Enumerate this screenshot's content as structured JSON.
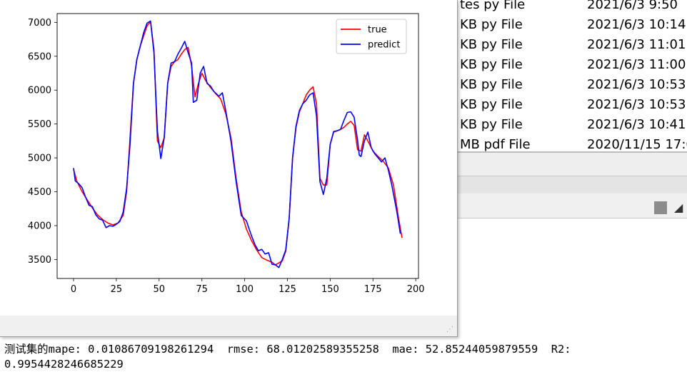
{
  "explorer": {
    "files": [
      {
        "name": "tes py File",
        "date": "2021/6/3 9:50"
      },
      {
        "name": "KB py File",
        "date": "2021/6/3 10:14"
      },
      {
        "name": "KB py File",
        "date": "2021/6/3 11:01"
      },
      {
        "name": "KB py File",
        "date": "2021/6/3 11:00"
      },
      {
        "name": "KB py File",
        "date": "2021/6/3 10:53"
      },
      {
        "name": "KB py File",
        "date": "2021/6/3 10:53"
      },
      {
        "name": "KB py File",
        "date": "2021/6/3 10:41"
      },
      {
        "name": "MB pdf File",
        "date": "2020/11/15 17:0"
      }
    ]
  },
  "console": {
    "line1": "测试集的mape: 0.01086709198261294  rmse: 68.01202589355258  mae: 52.85244059879559  R2:",
    "line2": "0.9954428246685229"
  },
  "chart_data": {
    "type": "line",
    "title": "",
    "xlabel": "",
    "ylabel": "",
    "xlim": [
      -9.6,
      201.6
    ],
    "ylim": [
      3220,
      7130
    ],
    "xticks": [
      0,
      25,
      50,
      75,
      100,
      125,
      150,
      175,
      200
    ],
    "yticks": [
      3500,
      4000,
      4500,
      5000,
      5500,
      6000,
      6500,
      7000
    ],
    "legend_position": "top-right",
    "grid": false,
    "series": [
      {
        "name": "true",
        "color": "#ff0000",
        "points": [
          [
            0,
            4830
          ],
          [
            2,
            4650
          ],
          [
            5,
            4500
          ],
          [
            8,
            4380
          ],
          [
            11,
            4260
          ],
          [
            14,
            4160
          ],
          [
            17,
            4090
          ],
          [
            20,
            4040
          ],
          [
            23,
            4010
          ],
          [
            26,
            4040
          ],
          [
            29,
            4150
          ],
          [
            31,
            4500
          ],
          [
            33,
            5300
          ],
          [
            35,
            6100
          ],
          [
            37,
            6450
          ],
          [
            39,
            6650
          ],
          [
            41,
            6800
          ],
          [
            43,
            6950
          ],
          [
            45,
            7010
          ],
          [
            47,
            6600
          ],
          [
            49,
            5250
          ],
          [
            51,
            5150
          ],
          [
            53,
            5300
          ],
          [
            55,
            6100
          ],
          [
            57,
            6350
          ],
          [
            59,
            6420
          ],
          [
            61,
            6450
          ],
          [
            63,
            6530
          ],
          [
            65,
            6600
          ],
          [
            67,
            6630
          ],
          [
            69,
            6350
          ],
          [
            71,
            5900
          ],
          [
            73,
            6100
          ],
          [
            75,
            6250
          ],
          [
            77,
            6150
          ],
          [
            80,
            6040
          ],
          [
            83,
            5950
          ],
          [
            86,
            5870
          ],
          [
            89,
            5650
          ],
          [
            92,
            5300
          ],
          [
            95,
            4700
          ],
          [
            98,
            4200
          ],
          [
            101,
            3950
          ],
          [
            104,
            3780
          ],
          [
            107,
            3640
          ],
          [
            110,
            3530
          ],
          [
            113,
            3490
          ],
          [
            116,
            3460
          ],
          [
            118,
            3420
          ],
          [
            120,
            3450
          ],
          [
            122,
            3480
          ],
          [
            124,
            3620
          ],
          [
            126,
            4100
          ],
          [
            128,
            5000
          ],
          [
            130,
            5450
          ],
          [
            132,
            5680
          ],
          [
            134,
            5800
          ],
          [
            136,
            5930
          ],
          [
            138,
            6000
          ],
          [
            140,
            6050
          ],
          [
            142,
            5800
          ],
          [
            144,
            4700
          ],
          [
            146,
            4600
          ],
          [
            148,
            4600
          ],
          [
            150,
            5200
          ],
          [
            152,
            5380
          ],
          [
            154,
            5400
          ],
          [
            156,
            5420
          ],
          [
            158,
            5450
          ],
          [
            160,
            5500
          ],
          [
            162,
            5540
          ],
          [
            164,
            5480
          ],
          [
            166,
            5120
          ],
          [
            168,
            5100
          ],
          [
            170,
            5340
          ],
          [
            172,
            5250
          ],
          [
            175,
            5100
          ],
          [
            178,
            5020
          ],
          [
            181,
            4950
          ],
          [
            184,
            4850
          ],
          [
            187,
            4600
          ],
          [
            190,
            4100
          ],
          [
            192,
            3820
          ]
        ]
      },
      {
        "name": "predict",
        "color": "#0000ff",
        "points": [
          [
            0,
            4850
          ],
          [
            1,
            4660
          ],
          [
            3,
            4620
          ],
          [
            5,
            4560
          ],
          [
            7,
            4420
          ],
          [
            9,
            4300
          ],
          [
            11,
            4280
          ],
          [
            13,
            4160
          ],
          [
            15,
            4100
          ],
          [
            17,
            4080
          ],
          [
            19,
            3970
          ],
          [
            21,
            4000
          ],
          [
            23,
            3990
          ],
          [
            25,
            4020
          ],
          [
            27,
            4060
          ],
          [
            29,
            4200
          ],
          [
            31,
            4550
          ],
          [
            33,
            5200
          ],
          [
            35,
            6100
          ],
          [
            37,
            6450
          ],
          [
            39,
            6650
          ],
          [
            41,
            6850
          ],
          [
            43,
            6990
          ],
          [
            45,
            7020
          ],
          [
            47,
            6550
          ],
          [
            49,
            5400
          ],
          [
            51,
            4990
          ],
          [
            53,
            5300
          ],
          [
            55,
            6100
          ],
          [
            57,
            6400
          ],
          [
            59,
            6420
          ],
          [
            61,
            6530
          ],
          [
            63,
            6620
          ],
          [
            65,
            6720
          ],
          [
            67,
            6550
          ],
          [
            69,
            6400
          ],
          [
            70,
            5820
          ],
          [
            72,
            5850
          ],
          [
            74,
            6250
          ],
          [
            76,
            6350
          ],
          [
            78,
            6100
          ],
          [
            80,
            6060
          ],
          [
            82,
            5980
          ],
          [
            85,
            5910
          ],
          [
            87,
            5960
          ],
          [
            89,
            5690
          ],
          [
            92,
            5250
          ],
          [
            95,
            4650
          ],
          [
            98,
            4150
          ],
          [
            101,
            4070
          ],
          [
            104,
            3850
          ],
          [
            106,
            3720
          ],
          [
            108,
            3630
          ],
          [
            110,
            3650
          ],
          [
            112,
            3580
          ],
          [
            114,
            3600
          ],
          [
            116,
            3430
          ],
          [
            118,
            3420
          ],
          [
            120,
            3380
          ],
          [
            122,
            3500
          ],
          [
            124,
            3640
          ],
          [
            126,
            4100
          ],
          [
            128,
            5000
          ],
          [
            130,
            5470
          ],
          [
            132,
            5700
          ],
          [
            134,
            5800
          ],
          [
            136,
            5850
          ],
          [
            138,
            5930
          ],
          [
            140,
            5960
          ],
          [
            142,
            5620
          ],
          [
            144,
            4650
          ],
          [
            146,
            4460
          ],
          [
            148,
            4700
          ],
          [
            150,
            5200
          ],
          [
            152,
            5390
          ],
          [
            154,
            5400
          ],
          [
            156,
            5420
          ],
          [
            158,
            5550
          ],
          [
            160,
            5670
          ],
          [
            162,
            5680
          ],
          [
            164,
            5600
          ],
          [
            166,
            5260
          ],
          [
            167,
            5040
          ],
          [
            168,
            5020
          ],
          [
            170,
            5250
          ],
          [
            172,
            5380
          ],
          [
            174,
            5150
          ],
          [
            176,
            5060
          ],
          [
            178,
            5000
          ],
          [
            180,
            4940
          ],
          [
            182,
            5000
          ],
          [
            184,
            4820
          ],
          [
            186,
            4600
          ],
          [
            189,
            4200
          ],
          [
            191,
            3880
          ]
        ]
      }
    ]
  },
  "colors": {
    "true_line": "#ff0000",
    "predict_line": "#0000ff"
  },
  "icons": {
    "stop": "stop-square-icon",
    "clear": "eraser-icon",
    "grip": "resize-grip-icon"
  }
}
